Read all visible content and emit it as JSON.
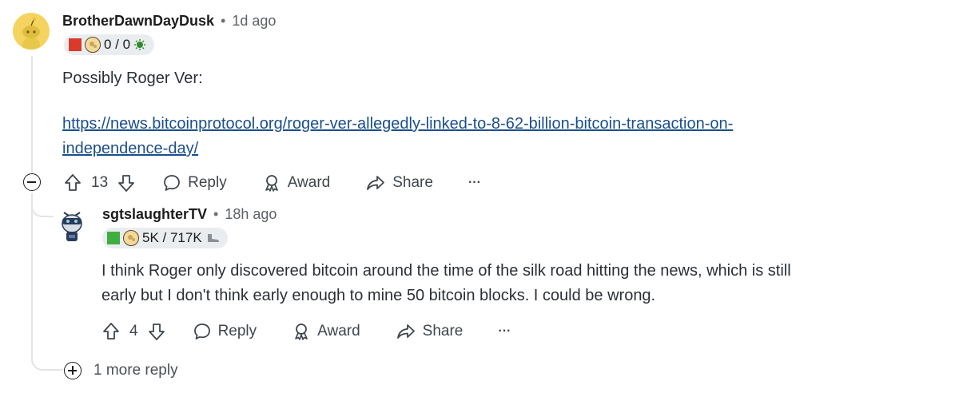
{
  "comment1": {
    "author": "BrotherDawnDayDusk",
    "separator": "•",
    "time": "1d ago",
    "flair_text": "0 / 0",
    "flair_square_color": "#d93a2b",
    "body": "Possibly Roger Ver:",
    "link_line1": "https://news.bitcoinprotocol.org/roger-ver-allegedly-linked-to-8-62-billion-bitcoin-transaction-on-",
    "link_line2": "independence-day/",
    "votes": "13",
    "reply_label": "Reply",
    "award_label": "Award",
    "share_label": "Share",
    "more_label": "···"
  },
  "comment2": {
    "author": "sgtslaughterTV",
    "separator": "•",
    "time": "18h ago",
    "flair_text": "5K / 717K",
    "flair_square_color": "#3fae3f",
    "body_line1": "I think Roger only discovered bitcoin around the time of the silk road hitting the news, which is still",
    "body_line2": "early but I don't think early enough to mine 50 bitcoin blocks. I could be wrong.",
    "votes": "4",
    "reply_label": "Reply",
    "award_label": "Award",
    "share_label": "Share",
    "more_label": "···"
  },
  "more_replies": "1 more reply",
  "icons": [
    "upvote-icon",
    "downvote-icon",
    "reply-icon",
    "award-icon",
    "share-icon",
    "more-icon",
    "collapse-icon",
    "expand-icon"
  ],
  "colors": {
    "link": "#1a4f8c",
    "thread": "#e2e4e6",
    "flair_bg": "#eaedef"
  }
}
